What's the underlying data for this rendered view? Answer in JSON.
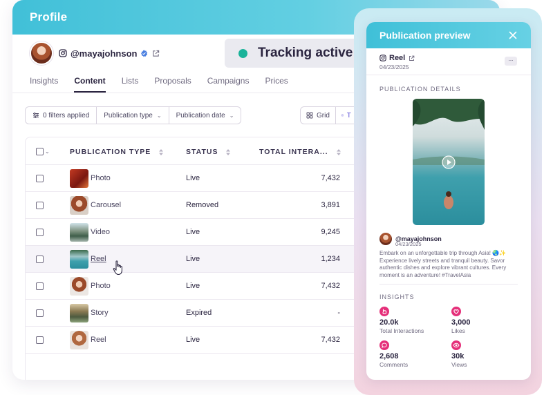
{
  "profile": {
    "title": "Profile",
    "username": "@mayajohnson",
    "tabs": [
      {
        "label": "Insights",
        "active": false
      },
      {
        "label": "Content",
        "active": true
      },
      {
        "label": "Lists",
        "active": false
      },
      {
        "label": "Proposals",
        "active": false
      },
      {
        "label": "Campaigns",
        "active": false
      },
      {
        "label": "Prices",
        "active": false
      }
    ],
    "filters": {
      "applied": "0 filters applied",
      "publication_type": "Publication type",
      "publication_date": "Publication date"
    },
    "view_toggle": {
      "grid": "Grid",
      "table": "T"
    }
  },
  "table": {
    "columns": [
      "PUBLICATION TYPE",
      "STATUS",
      "TOTAL INTERA..."
    ],
    "rows": [
      {
        "type": "Photo",
        "status": "Live",
        "total": "7,432",
        "thumb": "red-foliage"
      },
      {
        "type": "Carousel",
        "status": "Removed",
        "total": "3,891",
        "thumb": "portrait"
      },
      {
        "type": "Video",
        "status": "Live",
        "total": "9,245",
        "thumb": "mountains"
      },
      {
        "type": "Reel",
        "status": "Live",
        "total": "1,234",
        "thumb": "pool"
      },
      {
        "type": "Photo",
        "status": "Live",
        "total": "7,432",
        "thumb": "portrait"
      },
      {
        "type": "Story",
        "status": "Expired",
        "total": "-",
        "thumb": "city"
      },
      {
        "type": "Reel",
        "status": "Live",
        "total": "7,432",
        "thumb": "portrait-light"
      }
    ]
  },
  "tracking": {
    "label": "Tracking active",
    "color": "#1bb39a"
  },
  "preview": {
    "title": "Publication preview",
    "type": "Reel",
    "date": "04/23/2025",
    "more": "...",
    "details_label": "PUBLICATION DETAILS",
    "author": "@mayajohnson",
    "author_date": "04/23/2025",
    "caption": "Embark on an unforgettable trip through Asia! 🌏✨ Experience lively streets and tranquil beauty. Savor authentic dishes and explore vibrant cultures. Every moment is an adventure! #TravelAsia",
    "insights_label": "INSIGHTS",
    "insights": [
      {
        "value": "20.0k",
        "label": "Total Interactions",
        "icon": "hand-icon"
      },
      {
        "value": "3,000",
        "label": "Likes",
        "icon": "heart-icon"
      },
      {
        "value": "2,608",
        "label": "Comments",
        "icon": "comment-icon"
      },
      {
        "value": "30k",
        "label": "Views",
        "icon": "eye-icon"
      }
    ],
    "accent": "#e5307a"
  }
}
